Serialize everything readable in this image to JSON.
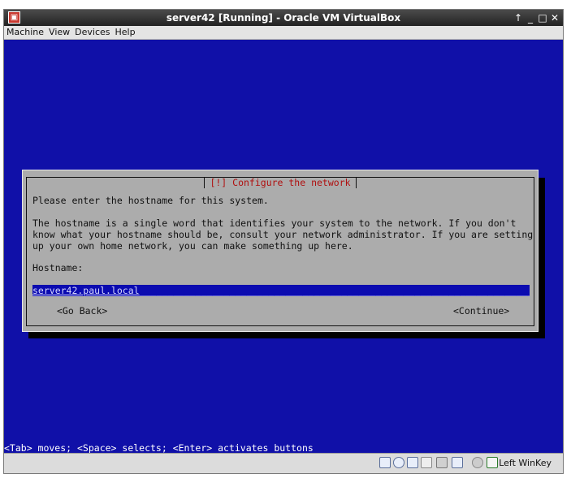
{
  "window": {
    "title": "server42 [Running] - Oracle VM VirtualBox",
    "controls": {
      "up": "↑",
      "minimize": "_",
      "maximize": "□",
      "close": "✕"
    }
  },
  "menubar": {
    "items": [
      "Machine",
      "View",
      "Devices",
      "Help"
    ]
  },
  "dialog": {
    "title": "[!] Configure the network",
    "prompt": "Please enter the hostname for this system.",
    "description_lines": [
      "The hostname is a single word that identifies your system to the network. If you don't",
      "know what your hostname should be, consult your network administrator. If you are setting",
      "up your own home network, you can make something up here."
    ],
    "field_label": "Hostname:",
    "hostname_value": "server42.paul.local",
    "go_back": "<Go Back>",
    "continue": "<Continue>"
  },
  "status_line": "<Tab> moves; <Space> selects; <Enter> activates buttons",
  "statusbar": {
    "host_key": "Left WinKey"
  },
  "colors": {
    "vm_background": "#1010a8",
    "dialog_background": "#acacac",
    "dialog_title": "#b01010",
    "input_background": "#0b0bb0"
  },
  "icons": [
    "hard-disk-icon",
    "optical-drive-icon",
    "network-icon",
    "shared-folders-icon",
    "usb-icon",
    "display-icon",
    "mouse-integration-icon",
    "host-key-icon"
  ]
}
